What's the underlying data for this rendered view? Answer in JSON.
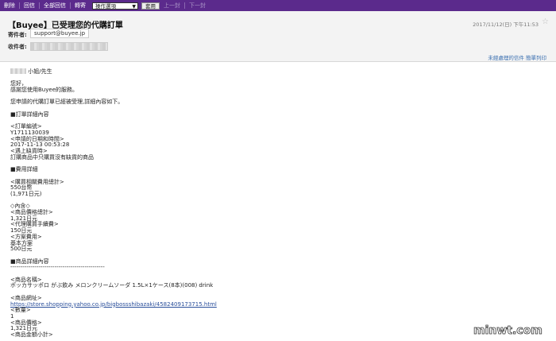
{
  "toolbar": {
    "delete": "刪除",
    "reply": "回信",
    "reply_all": "全部回信",
    "forward": "轉寄",
    "select_value": "操作選項",
    "apply": "套用",
    "prev": "上一封",
    "next": "下一封"
  },
  "header": {
    "subject": "【Buyee】已受理您的代購訂單",
    "datetime": "2017/11/12(日) 下午11:53",
    "from_label": "寄件者:",
    "from_value": "support@buyee.jp",
    "to_label": "收件者:",
    "links": "未經處理的信件 簡單列印"
  },
  "body": {
    "greeting_suffix": "小姐/先生",
    "lines1": [
      "您好，",
      "感謝您使用Buyee的服務。"
    ],
    "line_intro": "您申請的代購訂單已經被受理,詳細內容如下。",
    "section_order": "■訂單詳細內容",
    "order_lines": [
      "<訂單編號>",
      "Y1711130039",
      "<申請的日期和時間>",
      "2017-11-13 00:53:28",
      "<遇上缺貨時>",
      "訂購商品中只購買沒有缺貨的商品"
    ],
    "section_fee": "■費用詳細",
    "fee_lines": [
      "<購買相關費用總計>",
      "550台幣",
      "(1,971日元)"
    ],
    "breakdown_lines": [
      "◇內含◇",
      "<商品價格總計>",
      "1,321日元",
      "<代理購買手續費>",
      "150日元",
      "<方案費用>",
      "基本方案",
      "500日元"
    ],
    "section_items": "■商品詳細內容",
    "divider": "-----------------------------------------------",
    "item_lines": [
      "<商品名稱>",
      "ポッカサッポロ がぶ飲み メロンクリームソーダ 1.5L×1ケース(8本)(008) drink"
    ],
    "url_label": "<商品網址>",
    "url": "https://store.shopping.yahoo.co.jp/bigbossshibazaki/4582409173715.html",
    "tail_lines": [
      "<數量>",
      "1",
      "<商品價格>",
      "1,321日元",
      "<商品金額小計>"
    ]
  },
  "watermark": "minwt.com",
  "colors": {
    "toolbar_bg": "#5b2a8c",
    "header_bg": "#f3f3f3",
    "link": "#2a4f9b"
  }
}
